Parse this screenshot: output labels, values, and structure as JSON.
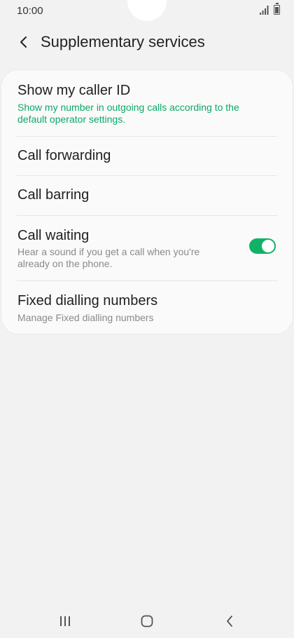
{
  "status": {
    "time": "10:00"
  },
  "header": {
    "title": "Supplementary services"
  },
  "settings": [
    {
      "title": "Show my caller ID",
      "subtitle": "Show my number in outgoing calls according to the default operator settings."
    },
    {
      "title": "Call forwarding"
    },
    {
      "title": "Call barring"
    },
    {
      "title": "Call waiting",
      "subtitle": "Hear a sound if you get a call when you're already on the phone.",
      "enabled": true
    },
    {
      "title": "Fixed dialling numbers",
      "subtitle": "Manage Fixed dialling numbers"
    }
  ],
  "icons": {
    "back": "chevron-left-icon",
    "signal": "signal-icon",
    "battery": "battery-icon",
    "nav_recents": "recents-icon",
    "nav_home": "home-icon",
    "nav_back": "back-icon"
  },
  "colors": {
    "accent": "#0aa86a",
    "toggle_on": "#12b168",
    "background": "#f2f2f2",
    "card": "#fafafa"
  }
}
